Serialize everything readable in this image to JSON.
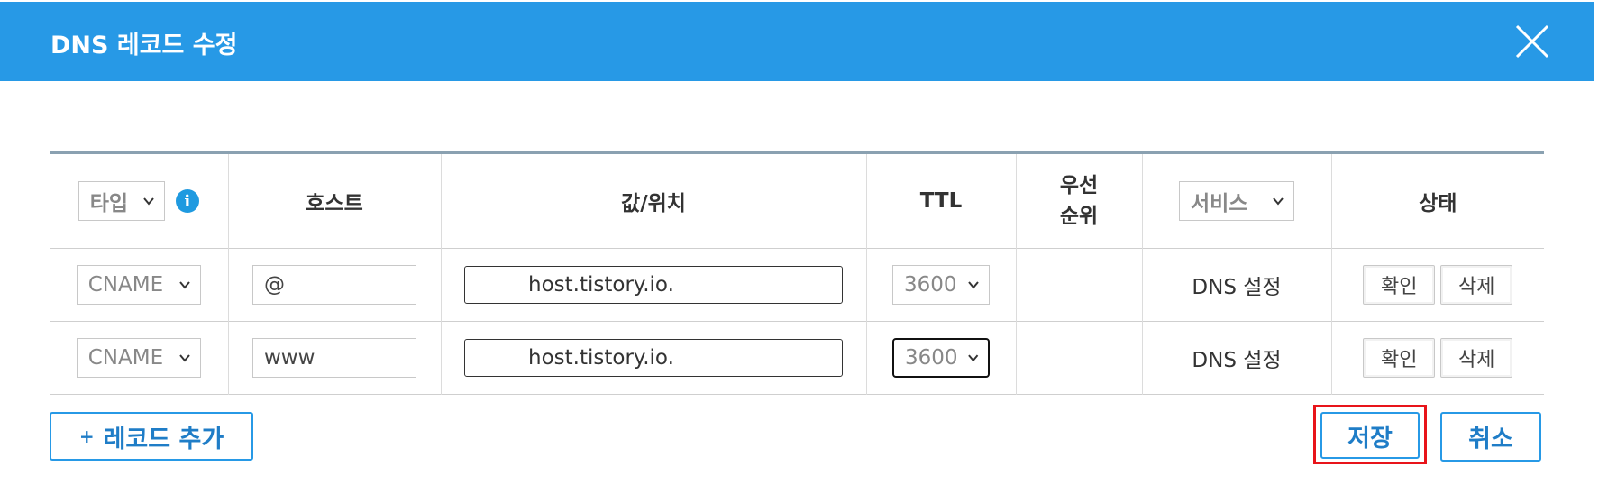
{
  "dialog": {
    "title": "DNS 레코드 수정",
    "close_icon": "close-icon"
  },
  "table": {
    "headers": {
      "type_select": "타입",
      "host": "호스트",
      "value": "값/위치",
      "ttl": "TTL",
      "priority": "우선\n순위",
      "service_select": "서비스",
      "status": "상태"
    },
    "rows": [
      {
        "type": "CNAME",
        "host": "@",
        "value": "host.tistory.io.",
        "ttl": "3600",
        "priority": "",
        "service": "DNS 설정",
        "confirm_label": "확인",
        "delete_label": "삭제"
      },
      {
        "type": "CNAME",
        "host": "www",
        "value": "host.tistory.io.",
        "ttl": "3600",
        "priority": "",
        "service": "DNS 설정",
        "confirm_label": "확인",
        "delete_label": "삭제"
      }
    ]
  },
  "footer": {
    "add_plus": "+",
    "add_label": "레코드 추가",
    "save_label": "저장",
    "cancel_label": "취소"
  },
  "colors": {
    "header_bg": "#2799e6",
    "accent": "#1f7dc7",
    "highlight": "#e8141a"
  }
}
